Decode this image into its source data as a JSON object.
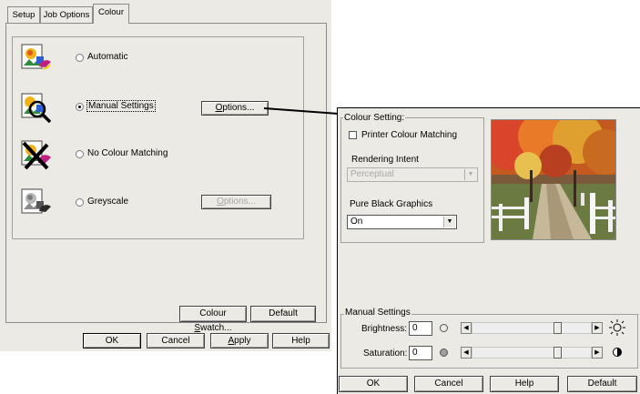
{
  "tabs": [
    {
      "label": "Setup"
    },
    {
      "label": "Job Options"
    },
    {
      "label": "Colour"
    }
  ],
  "colour_modes": [
    {
      "label": "Automatic",
      "selected": false,
      "icon": "colour-graphic-icon"
    },
    {
      "label": "Manual Settings",
      "selected": true,
      "icon": "magnifier-colour-icon"
    },
    {
      "label": "No Colour Matching",
      "selected": false,
      "icon": "crossed-colour-icon"
    },
    {
      "label": "Greyscale",
      "selected": false,
      "icon": "greyscale-graphic-icon"
    }
  ],
  "manual_options_button": {
    "prefix": "",
    "mnemonic": "O",
    "suffix": "ptions..."
  },
  "greyscale_options_button": {
    "prefix": "",
    "mnemonic": "O",
    "suffix": "ptions..."
  },
  "colour_swatch_button": {
    "prefix": "Colour ",
    "mnemonic": "S",
    "suffix": "watch..."
  },
  "default_button": "Default",
  "dialog_buttons": {
    "ok": "OK",
    "cancel": "Cancel",
    "apply_mnemonic": "A",
    "apply_suffix": "pply",
    "help": "Help"
  },
  "colour_setting": {
    "group_label": "Colour Setting:",
    "printer_colour_matching": {
      "label": "Printer Colour Matching",
      "checked": false
    },
    "rendering_intent": {
      "label": "Rendering Intent",
      "value": "Perceptual",
      "enabled": false
    },
    "pure_black_graphics": {
      "label": "Pure Black Graphics",
      "value": "On"
    },
    "preview_image": "autumn-lane-photo"
  },
  "manual_settings": {
    "group_label": "Manual Settings",
    "brightness": {
      "label": "Brightness:",
      "value": "0",
      "level": 0.72,
      "icon_low": "circle-outline-icon",
      "icon_high": "sun-icon"
    },
    "saturation": {
      "label": "Saturation:",
      "value": "0",
      "level": 0.72,
      "icon_low": "grey-circle-icon",
      "icon_high": "half-circle-icon"
    }
  },
  "options_buttons": {
    "ok": "OK",
    "cancel": "Cancel",
    "help": "Help",
    "default": "Default"
  },
  "colors": {
    "dialog_bg": "#eceae4",
    "disabled_text": "#a8a8a8"
  }
}
